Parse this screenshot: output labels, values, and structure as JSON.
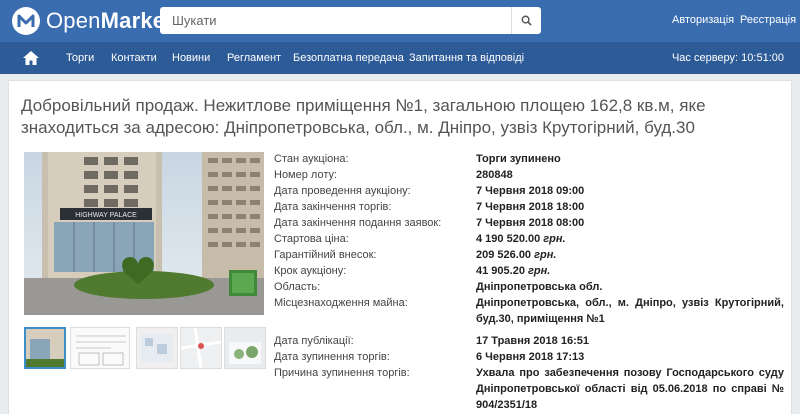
{
  "header": {
    "logo_text_a": "Open",
    "logo_text_b": "Market",
    "search_placeholder": "Шукати",
    "login": "Авторизація",
    "register": "Реєстрація"
  },
  "nav": {
    "items": [
      "Торги",
      "Контакти",
      "Новини",
      "Регламент",
      "Безоплатна передача",
      "Запитання та відповіді"
    ],
    "server_time_label": "Час серверу:",
    "server_time": "10:51:00"
  },
  "lot": {
    "title": "Добровільний продаж. Нежитлове приміщення №1, загальною площею 162,8 кв.м, яке знаходиться за адресою: Дніпропетровська, обл., м. Дніпро, узвіз Крутогірний, буд.30",
    "photo_sign": "HIGHWAY PALACE",
    "fields": [
      {
        "label": "Стан аукціона:",
        "value": "Торги зупинено"
      },
      {
        "label": "Номер лоту:",
        "value": "280848"
      },
      {
        "label": "Дата проведення аукціону:",
        "value": "7 Червня 2018 09:00"
      },
      {
        "label": "Дата закінчення торгів:",
        "value": "7 Червня 2018 18:00"
      },
      {
        "label": "Дата закінчення подання заявок:",
        "value": "7 Червня 2018 08:00"
      },
      {
        "label": "Стартова ціна:",
        "value": "4 190 520.00",
        "unit": "грн."
      },
      {
        "label": "Гарантійний внесок:",
        "value": "209 526.00",
        "unit": "грн."
      },
      {
        "label": "Крок аукціону:",
        "value": "41 905.20",
        "unit": "грн."
      },
      {
        "label": "Область:",
        "value": "Дніпропетровська обл."
      },
      {
        "label": "Місцезнаходження майна:",
        "value": "Дніпропетровська, обл., м. Дніпро, узвіз Крутогірний, буд.30, приміщення №1"
      },
      {
        "label": "Дата публікації:",
        "value": "17 Травня 2018 16:51"
      },
      {
        "label": "Дата зупинення торгів:",
        "value": "6 Червня 2018 17:13"
      },
      {
        "label": "Причина зупинення торгів:",
        "value": "Ухвала про забезпечення позову Господарського суду Дніпропетровської області від 05.06.2018 по справі № 904/2351/18"
      }
    ]
  },
  "colors": {
    "header": "#3a6db0",
    "nav": "#2d5b97",
    "thumb_active": "#3a8fc9"
  }
}
